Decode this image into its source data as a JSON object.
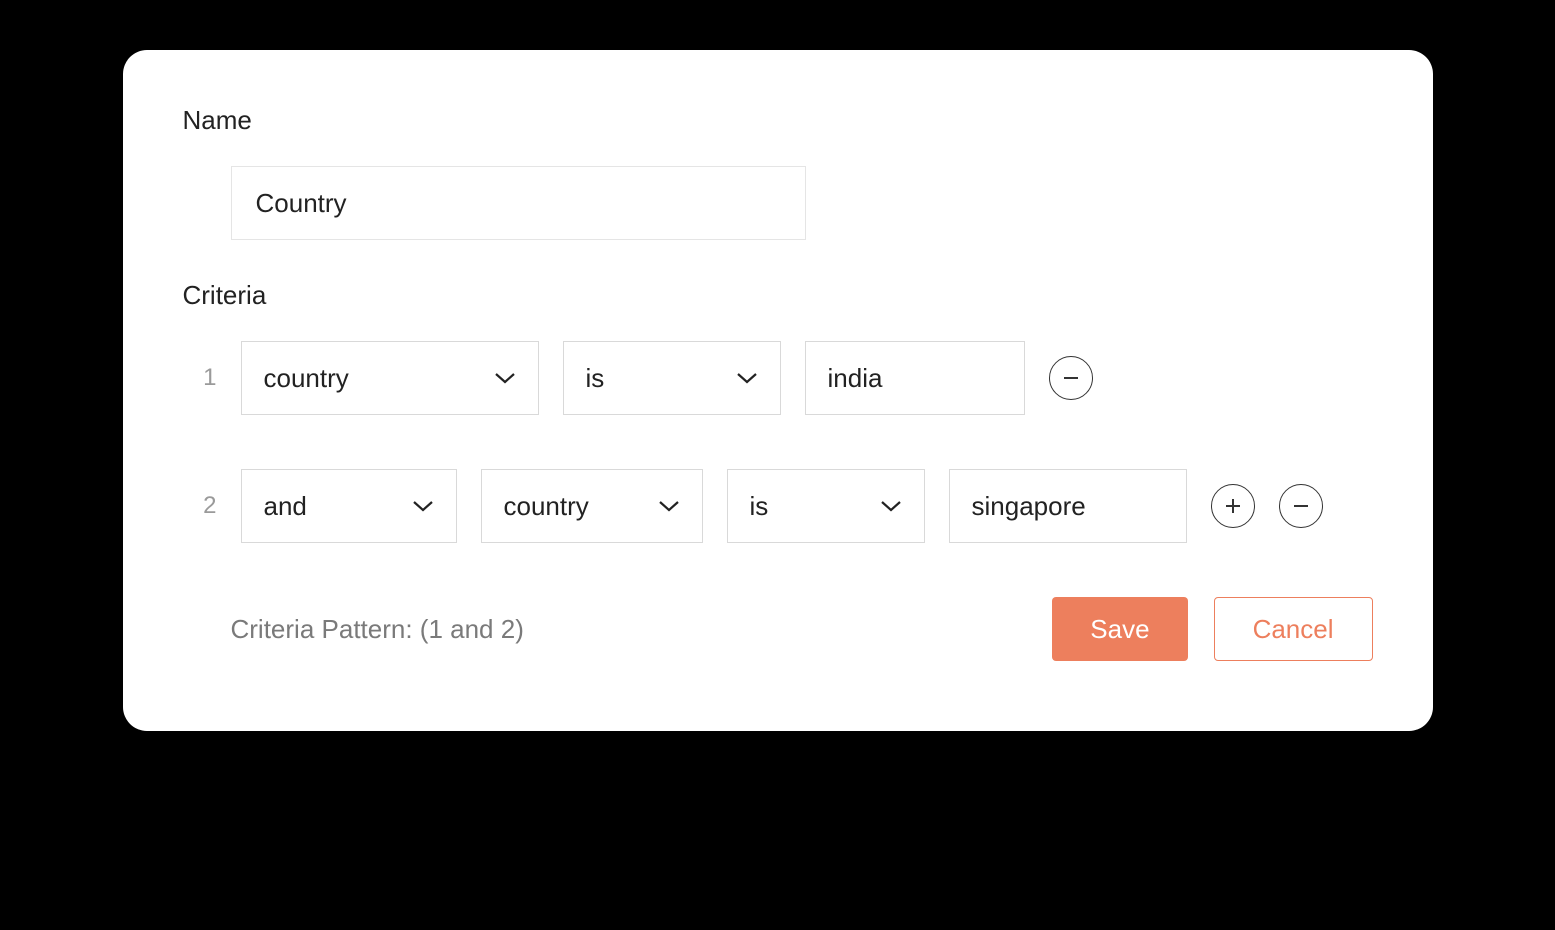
{
  "section": {
    "name_label": "Name",
    "name_value": "Country",
    "criteria_label": "Criteria"
  },
  "rows": [
    {
      "num": "1",
      "field": "country",
      "operator": "is",
      "value": "india"
    },
    {
      "num": "2",
      "logic": "and",
      "field": "country",
      "operator": "is",
      "value": "singapore"
    }
  ],
  "footer": {
    "pattern_label": "Criteria Pattern: (1 and 2)",
    "save_label": "Save",
    "cancel_label": "Cancel"
  },
  "colors": {
    "accent": "#ed7f5d"
  }
}
